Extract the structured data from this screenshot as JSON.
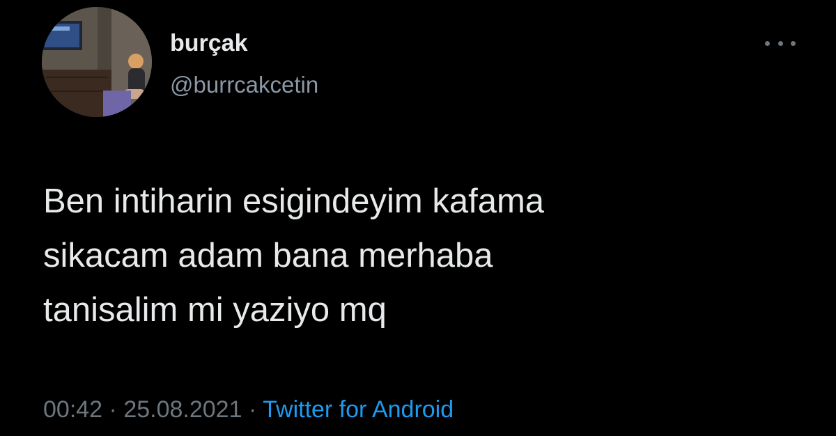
{
  "user": {
    "display_name": "burçak",
    "handle": "@burrcakcetin",
    "avatar_icon": "profile-photo"
  },
  "more_icon": "more-horizontal-icon",
  "tweet": {
    "lines": [
      "Ben intiharin esigindeyim kafama",
      "sikacam adam bana merhaba",
      "tanisalim mi yaziyo mq"
    ]
  },
  "meta": {
    "time": "00:42",
    "separator": "·",
    "date": "25.08.2021",
    "source": "Twitter for Android"
  },
  "colors": {
    "background": "#000000",
    "text": "#e7e9ea",
    "secondary": "#6e767d",
    "link": "#1d9bf0"
  }
}
